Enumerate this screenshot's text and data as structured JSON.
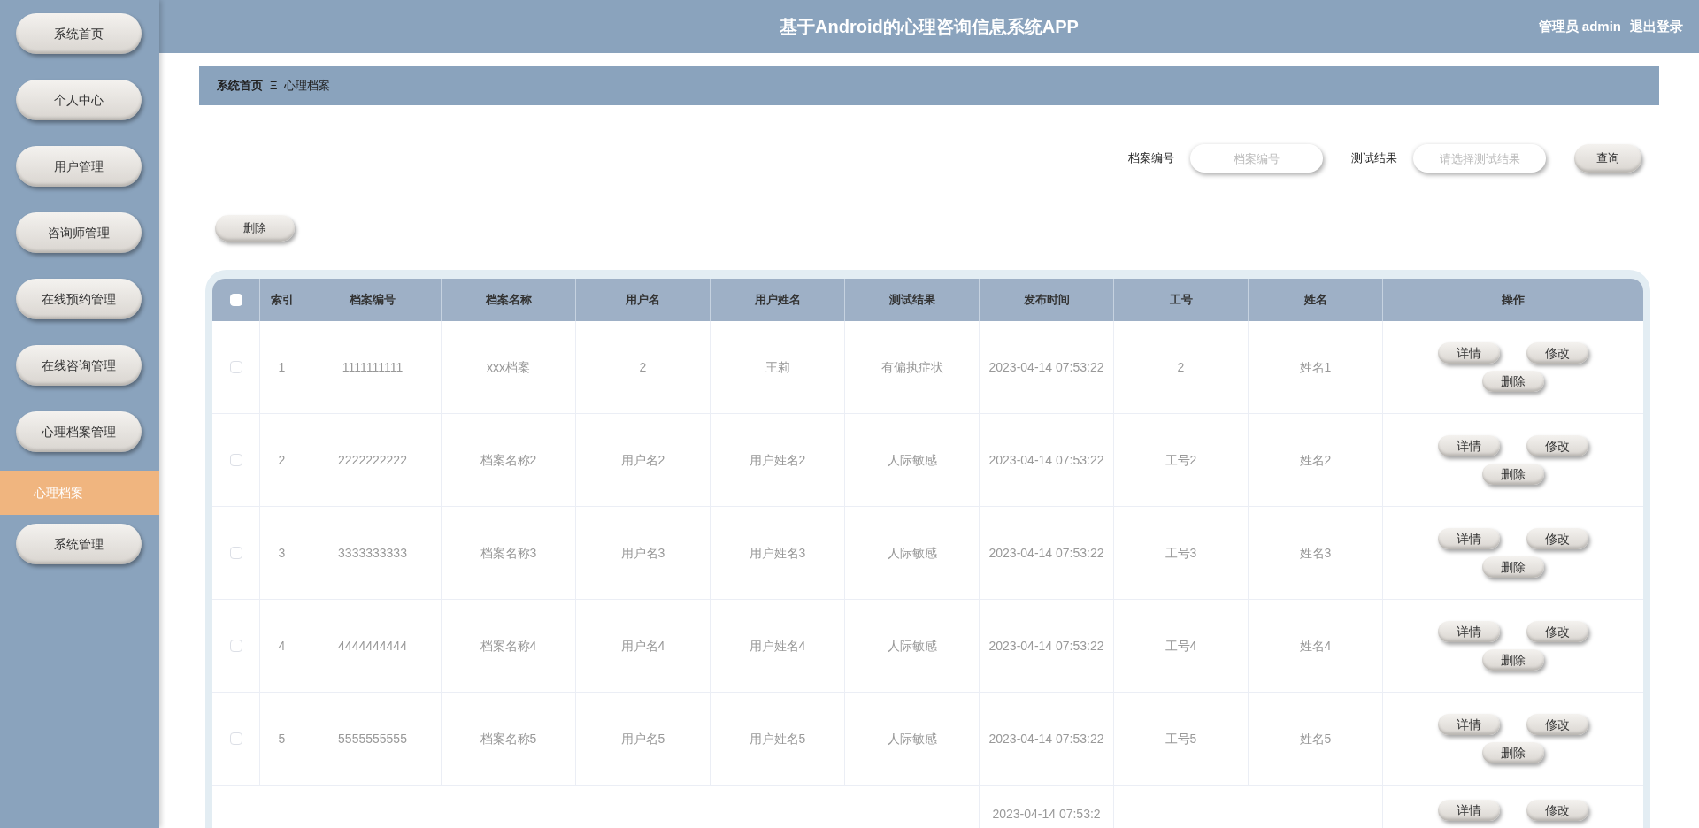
{
  "sidebar": {
    "items": [
      {
        "label": "系统首页",
        "kind": "pill",
        "selected": false
      },
      {
        "label": "个人中心",
        "kind": "pill",
        "selected": false
      },
      {
        "label": "用户管理",
        "kind": "pill",
        "selected": false
      },
      {
        "label": "咨询师管理",
        "kind": "pill",
        "selected": false
      },
      {
        "label": "在线预约管理",
        "kind": "pill",
        "selected": false
      },
      {
        "label": "在线咨询管理",
        "kind": "pill",
        "selected": false
      },
      {
        "label": "心理档案管理",
        "kind": "pill",
        "selected": false
      },
      {
        "label": "心理档案",
        "kind": "sub",
        "selected": true
      },
      {
        "label": "系统管理",
        "kind": "pill",
        "selected": false
      }
    ]
  },
  "header": {
    "title": "基于Android的心理咨询信息系统APP",
    "user": "管理员 admin",
    "logout": "退出登录"
  },
  "breadcrumb": {
    "home": "系统首页",
    "separator": "Ξ",
    "current": "心理档案"
  },
  "search": {
    "fields": [
      {
        "label": "档案编号",
        "placeholder": "档案编号"
      },
      {
        "label": "测试结果",
        "placeholder": "请选择测试结果"
      }
    ],
    "button": "查询"
  },
  "delete_button": "删除",
  "table": {
    "header_checked": false,
    "columns": [
      "索引",
      "档案编号",
      "档案名称",
      "用户名",
      "用户姓名",
      "测试结果",
      "发布时间",
      "工号",
      "姓名",
      "操作"
    ],
    "rows": [
      {
        "checked": false,
        "cells": [
          "1",
          "1111111111",
          "xxx档案",
          "2",
          "王莉",
          "有偏执症状",
          "2023-04-14 07:53:22",
          "2",
          "姓名1"
        ],
        "actions": [
          "详情",
          "修改",
          "删除"
        ]
      },
      {
        "checked": false,
        "cells": [
          "2",
          "2222222222",
          "档案名称2",
          "用户名2",
          "用户姓名2",
          "人际敏感",
          "2023-04-14 07:53:22",
          "工号2",
          "姓名2"
        ],
        "actions": [
          "详情",
          "修改",
          "删除"
        ]
      },
      {
        "checked": false,
        "cells": [
          "3",
          "3333333333",
          "档案名称3",
          "用户名3",
          "用户姓名3",
          "人际敏感",
          "2023-04-14 07:53:22",
          "工号3",
          "姓名3"
        ],
        "actions": [
          "详情",
          "修改",
          "删除"
        ]
      },
      {
        "checked": false,
        "cells": [
          "4",
          "4444444444",
          "档案名称4",
          "用户名4",
          "用户姓名4",
          "人际敏感",
          "2023-04-14 07:53:22",
          "工号4",
          "姓名4"
        ],
        "actions": [
          "详情",
          "修改",
          "删除"
        ]
      },
      {
        "checked": false,
        "cells": [
          "5",
          "5555555555",
          "档案名称5",
          "用户名5",
          "用户姓名5",
          "人际敏感",
          "2023-04-14 07:53:22",
          "工号5",
          "姓名5"
        ],
        "actions": [
          "详情",
          "修改",
          "删除"
        ]
      }
    ],
    "partial_row": {
      "time": "2023-04-14 07:53:2",
      "actions": [
        "详情",
        "修改"
      ]
    }
  }
}
